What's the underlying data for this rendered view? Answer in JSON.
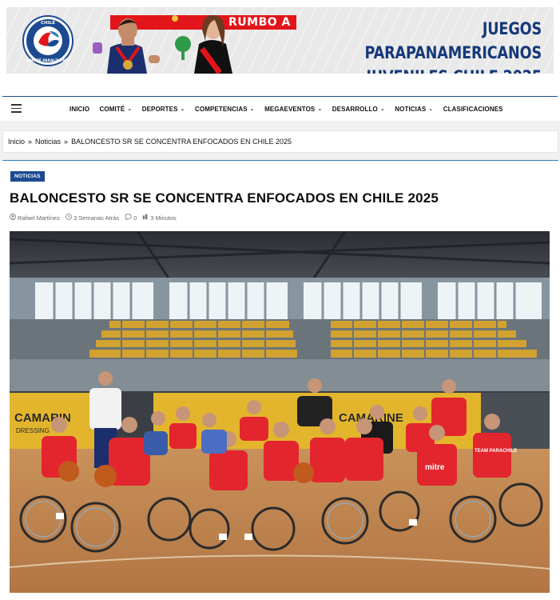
{
  "banner": {
    "logo_text_top": "CHILE",
    "logo_text_bottom": "COMITÉ PARALÍMPICO",
    "rumbo": "RUMBO A",
    "title_line1": "JUEGOS PARAPANAMERICANOS",
    "title_line2": "JUVENILES CHILE 2025"
  },
  "nav": {
    "items": [
      {
        "label": "INICIO",
        "chevron": false
      },
      {
        "label": "COMITÉ",
        "chevron": true
      },
      {
        "label": "DEPORTES",
        "chevron": true
      },
      {
        "label": "COMPETENCIAS",
        "chevron": true
      },
      {
        "label": "MEGAEVENTOS",
        "chevron": true
      },
      {
        "label": "DESARROLLO",
        "chevron": true
      },
      {
        "label": "NOTICIAS",
        "chevron": true
      },
      {
        "label": "CLASIFICACIONES",
        "chevron": false
      }
    ]
  },
  "breadcrumb": {
    "home": "Inicio",
    "section": "Noticias",
    "current": "BALONCESTO SR SE CONCENTRA ENFOCADOS EN CHILE 2025",
    "separator": "»"
  },
  "article": {
    "category": "NOTICIAS",
    "title": "BALONCESTO SR SE CONCENTRA ENFOCADOS EN CHILE 2025",
    "author": "Rafael Martínez",
    "time_ago": "3 Semanas Atrás",
    "comments": "0",
    "read_time": "3 Minutos"
  },
  "photo": {
    "sign_left": "CAMARIN",
    "sign_left_sub": "DRESSING",
    "sign_right": "CAMARINE",
    "jersey_brand": "mitre",
    "jersey_team": "TEAM PARACHILE"
  },
  "colors": {
    "brand_blue": "#1c4a91",
    "rumbo_red": "#e2151a",
    "jersey_red": "#e3262e"
  }
}
